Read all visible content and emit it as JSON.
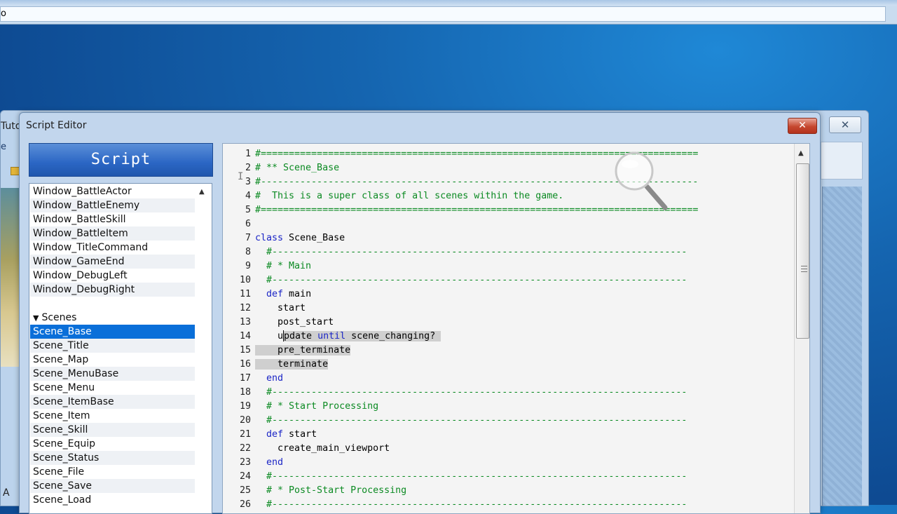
{
  "top_window": {
    "field_text": "o"
  },
  "background_window": {
    "title_fragment": "Tuto",
    "close_glyph": "✕",
    "left_fragment": "e",
    "bottom_fragment": "A"
  },
  "dialog": {
    "title": "Script Editor",
    "close_glyph": "✕",
    "panel_header": "Script"
  },
  "script_list": [
    {
      "label": "Window_BattleActor",
      "type": "item"
    },
    {
      "label": "Window_BattleEnemy",
      "type": "item"
    },
    {
      "label": "Window_BattleSkill",
      "type": "item"
    },
    {
      "label": "Window_BattleItem",
      "type": "item"
    },
    {
      "label": "Window_TitleCommand",
      "type": "item"
    },
    {
      "label": "Window_GameEnd",
      "type": "item"
    },
    {
      "label": "Window_DebugLeft",
      "type": "item"
    },
    {
      "label": "Window_DebugRight",
      "type": "item"
    },
    {
      "label": "",
      "type": "gap"
    },
    {
      "label": "Scenes",
      "type": "section"
    },
    {
      "label": "Scene_Base",
      "type": "selected"
    },
    {
      "label": "Scene_Title",
      "type": "item"
    },
    {
      "label": "Scene_Map",
      "type": "item"
    },
    {
      "label": "Scene_MenuBase",
      "type": "item"
    },
    {
      "label": "Scene_Menu",
      "type": "item"
    },
    {
      "label": "Scene_ItemBase",
      "type": "item"
    },
    {
      "label": "Scene_Item",
      "type": "item"
    },
    {
      "label": "Scene_Skill",
      "type": "item"
    },
    {
      "label": "Scene_Equip",
      "type": "item"
    },
    {
      "label": "Scene_Status",
      "type": "item"
    },
    {
      "label": "Scene_File",
      "type": "item"
    },
    {
      "label": "Scene_Save",
      "type": "item"
    },
    {
      "label": "Scene_Load",
      "type": "item"
    }
  ],
  "code": [
    {
      "n": "1",
      "text": "#==============================================================================",
      "style": "comment"
    },
    {
      "n": "2",
      "text": "# ** Scene_Base",
      "style": "comment"
    },
    {
      "n": "3",
      "text": "#------------------------------------------------------------------------------",
      "style": "comment"
    },
    {
      "n": "4",
      "text": "#  This is a super class of all scenes within the game.",
      "style": "comment"
    },
    {
      "n": "5",
      "text": "#==============================================================================",
      "style": "comment"
    },
    {
      "n": "6",
      "text": "",
      "style": "plain"
    },
    {
      "n": "7",
      "text": "class Scene_Base",
      "style": "kwline",
      "kw": "class",
      "rest": " Scene_Base",
      "indent": ""
    },
    {
      "n": "8",
      "text": "  #--------------------------------------------------------------------------",
      "style": "comment"
    },
    {
      "n": "9",
      "text": "  # * Main",
      "style": "comment"
    },
    {
      "n": "10",
      "text": "  #--------------------------------------------------------------------------",
      "style": "comment"
    },
    {
      "n": "11",
      "text": "  def main",
      "style": "kwline",
      "kw": "def",
      "rest": " main",
      "indent": "  "
    },
    {
      "n": "12",
      "text": "    start",
      "style": "plain"
    },
    {
      "n": "13",
      "text": "    post_start",
      "style": "plain"
    },
    {
      "n": "14",
      "text": "    update until scene_changing?",
      "style": "sel14"
    },
    {
      "n": "15",
      "text": "    pre_terminate",
      "style": "sel"
    },
    {
      "n": "16",
      "text": "    terminate",
      "style": "sel"
    },
    {
      "n": "17",
      "text": "  end",
      "style": "kwline",
      "kw": "end",
      "rest": "",
      "indent": "  "
    },
    {
      "n": "18",
      "text": "  #--------------------------------------------------------------------------",
      "style": "comment"
    },
    {
      "n": "19",
      "text": "  # * Start Processing",
      "style": "comment"
    },
    {
      "n": "20",
      "text": "  #--------------------------------------------------------------------------",
      "style": "comment"
    },
    {
      "n": "21",
      "text": "  def start",
      "style": "kwline",
      "kw": "def",
      "rest": " start",
      "indent": "  "
    },
    {
      "n": "22",
      "text": "    create_main_viewport",
      "style": "plain"
    },
    {
      "n": "23",
      "text": "  end",
      "style": "kwline",
      "kw": "end",
      "rest": "",
      "indent": "  "
    },
    {
      "n": "24",
      "text": "  #--------------------------------------------------------------------------",
      "style": "comment"
    },
    {
      "n": "25",
      "text": "  # * Post-Start Processing",
      "style": "comment"
    },
    {
      "n": "26",
      "text": "  #--------------------------------------------------------------------------",
      "style": "comment"
    }
  ],
  "colors": {
    "comment": "#0b8a22",
    "keyword": "#1a24c6",
    "selection": "#0a6fd9"
  }
}
